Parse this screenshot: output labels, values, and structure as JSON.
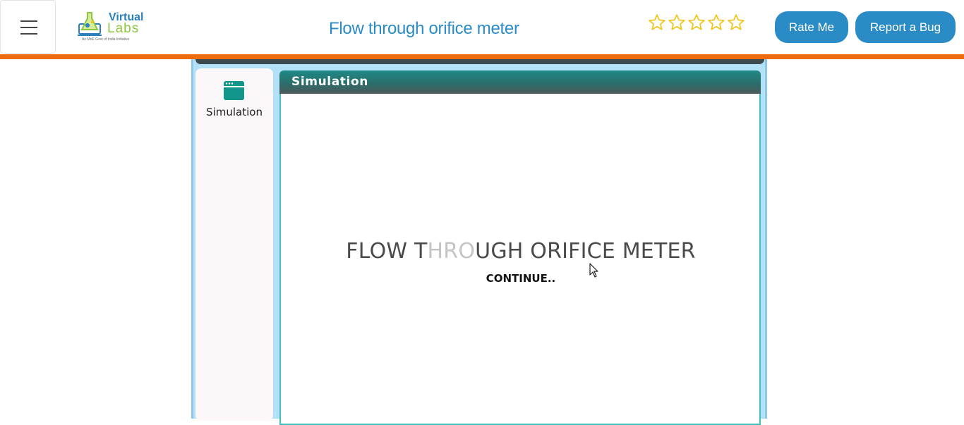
{
  "header": {
    "menu_icon": "hamburger-menu-icon",
    "logo": {
      "line1": "Virtual",
      "line2": "Labs",
      "tagline": "An MoE Govt of India Initiative"
    },
    "title": "Flow through orifice meter",
    "rating": {
      "stars_filled": 0,
      "stars_total": 5,
      "icon": "star-outline-icon"
    },
    "rate_button": "Rate Me",
    "bug_button": "Report a Bug"
  },
  "sidebar": {
    "items": [
      {
        "label": "Simulation",
        "icon": "window-icon"
      }
    ]
  },
  "panel": {
    "header_title": "Simulation",
    "sim_title_parts": [
      "FLOW T",
      "HRO",
      "UGH ORIFICE METER"
    ],
    "continue_label": "CONTINUE.."
  },
  "colors": {
    "accent_blue": "#2b8bc6",
    "orange": "#ee6b0c",
    "teal": "#1f8a86",
    "frame_light_blue": "#b3e1f7",
    "star_gold": "#f2c418"
  }
}
